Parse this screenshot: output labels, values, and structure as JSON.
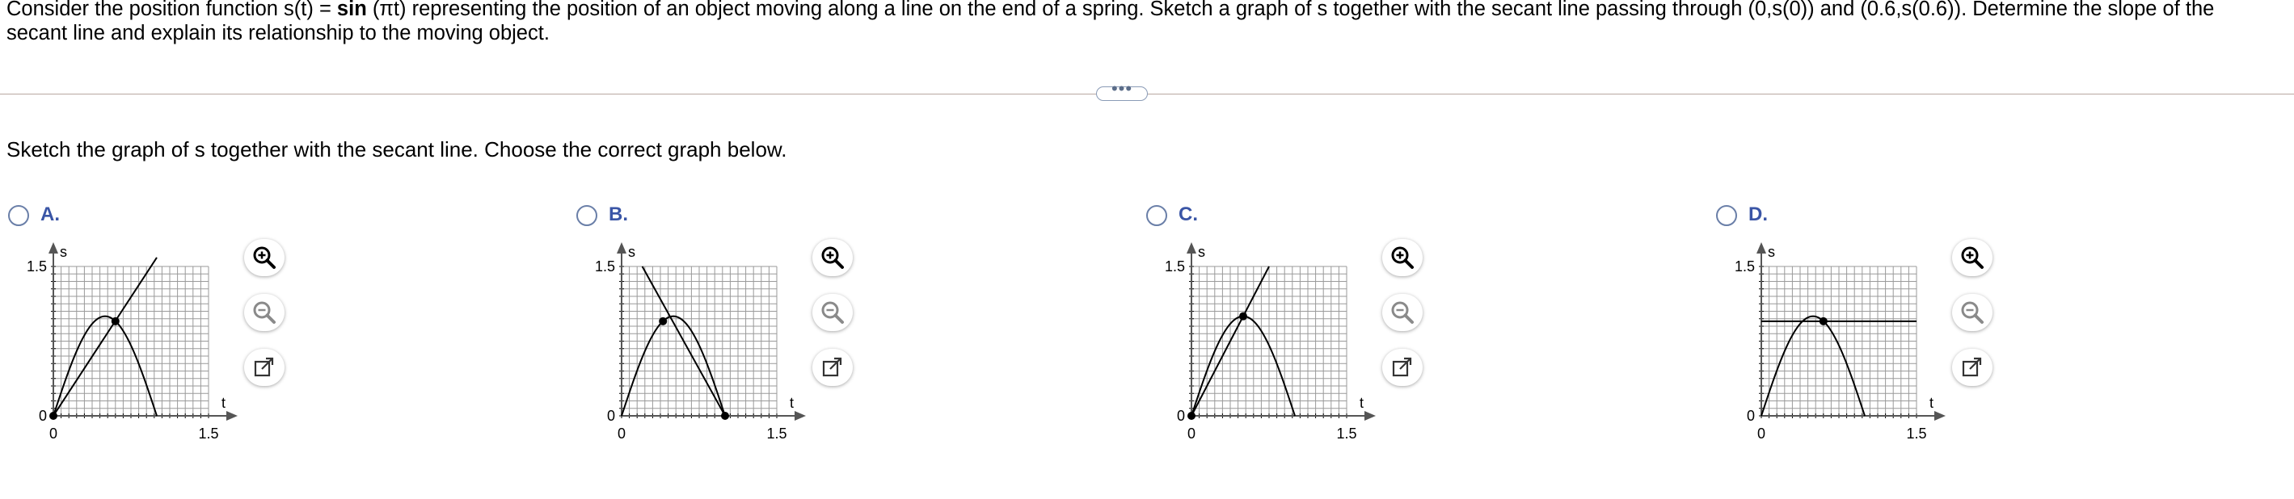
{
  "question": {
    "line1_a": "Consider the position function s(t) = ",
    "line1_func": "sin",
    "line1_b": " (πt) representing the position of an object moving along a line on the end of a spring. Sketch a graph of s together with the secant line passing through (0,s(0)) and (0.6,s(0.6)). Determine the slope of the",
    "line2": "secant line and explain its relationship to the moving object."
  },
  "more_button": {
    "label": "•••"
  },
  "instruction": "Sketch the graph of s together with the secant line. Choose the correct graph below.",
  "options": [
    {
      "label": "A.",
      "variant": "A"
    },
    {
      "label": "B.",
      "variant": "B"
    },
    {
      "label": "C.",
      "variant": "C"
    },
    {
      "label": "D.",
      "variant": "D"
    }
  ],
  "tools": {
    "zoom_in_icon": "zoom-in-icon",
    "zoom_out_icon": "zoom-out-icon",
    "popout_icon": "popout-icon"
  },
  "chart_data": [
    {
      "type": "line",
      "option": "A",
      "ylabel": "s",
      "xlabel": "t",
      "x_tick_labels": [
        "0",
        "1.5"
      ],
      "y_tick_labels": [
        "0",
        "1.5"
      ],
      "xlim": [
        0,
        1.5
      ],
      "ylim": [
        0,
        1.5
      ],
      "grid": true,
      "series": [
        {
          "kind": "curve",
          "function": "sin(pi t)",
          "x": [
            0,
            0.1,
            0.2,
            0.3,
            0.4,
            0.5,
            0.6,
            0.7,
            0.8,
            0.9,
            1.0
          ],
          "values": [
            0,
            0.31,
            0.59,
            0.81,
            0.95,
            1.0,
            0.95,
            0.81,
            0.59,
            0.31,
            0
          ]
        },
        {
          "kind": "secant",
          "x": [
            0,
            1.0
          ],
          "values": [
            0,
            1.59
          ]
        }
      ],
      "points": [
        {
          "x": 0,
          "y": 0
        },
        {
          "x": 0.6,
          "y": 0.95
        }
      ]
    },
    {
      "type": "line",
      "option": "B",
      "ylabel": "s",
      "xlabel": "t",
      "x_tick_labels": [
        "0",
        "1.5"
      ],
      "y_tick_labels": [
        "0",
        "1.5"
      ],
      "xlim": [
        0,
        1.5
      ],
      "ylim": [
        0,
        1.5
      ],
      "grid": true,
      "series": [
        {
          "kind": "curve",
          "function": "sin(pi t)",
          "x": [
            0,
            0.1,
            0.2,
            0.3,
            0.4,
            0.5,
            0.6,
            0.7,
            0.8,
            0.9,
            1.0
          ],
          "values": [
            0,
            0.31,
            0.59,
            0.81,
            0.95,
            1.0,
            0.95,
            0.81,
            0.59,
            0.31,
            0
          ]
        },
        {
          "kind": "secant",
          "x": [
            0.2,
            1.0
          ],
          "values": [
            1.5,
            0
          ]
        }
      ],
      "points": [
        {
          "x": 0.4,
          "y": 0.95
        },
        {
          "x": 1.0,
          "y": 0
        }
      ]
    },
    {
      "type": "line",
      "option": "C",
      "ylabel": "s",
      "xlabel": "t",
      "x_tick_labels": [
        "0",
        "1.5"
      ],
      "y_tick_labels": [
        "0",
        "1.5"
      ],
      "xlim": [
        0,
        1.5
      ],
      "ylim": [
        0,
        1.5
      ],
      "grid": true,
      "series": [
        {
          "kind": "curve",
          "function": "sin(pi t)",
          "x": [
            0,
            0.1,
            0.2,
            0.3,
            0.4,
            0.5,
            0.6,
            0.7,
            0.8,
            0.9,
            1.0
          ],
          "values": [
            0,
            0.31,
            0.59,
            0.81,
            0.95,
            1.0,
            0.95,
            0.81,
            0.59,
            0.31,
            0
          ]
        },
        {
          "kind": "secant",
          "x": [
            0,
            0.75
          ],
          "values": [
            0,
            1.5
          ]
        }
      ],
      "points": [
        {
          "x": 0,
          "y": 0
        },
        {
          "x": 0.5,
          "y": 1.0
        }
      ]
    },
    {
      "type": "line",
      "option": "D",
      "ylabel": "s",
      "xlabel": "t",
      "x_tick_labels": [
        "0",
        "1.5"
      ],
      "y_tick_labels": [
        "0",
        "1.5"
      ],
      "xlim": [
        0,
        1.5
      ],
      "ylim": [
        0,
        1.5
      ],
      "grid": true,
      "series": [
        {
          "kind": "curve",
          "function": "sin(pi t)",
          "x": [
            0,
            0.1,
            0.2,
            0.3,
            0.4,
            0.5,
            0.6,
            0.7,
            0.8,
            0.9,
            1.0
          ],
          "values": [
            0,
            0.31,
            0.59,
            0.81,
            0.95,
            1.0,
            0.95,
            0.81,
            0.59,
            0.31,
            0
          ]
        },
        {
          "kind": "secant",
          "x": [
            0,
            1.5
          ],
          "values": [
            0.95,
            0.95
          ]
        }
      ],
      "points": [
        {
          "x": 0.6,
          "y": 0.95
        }
      ]
    }
  ]
}
